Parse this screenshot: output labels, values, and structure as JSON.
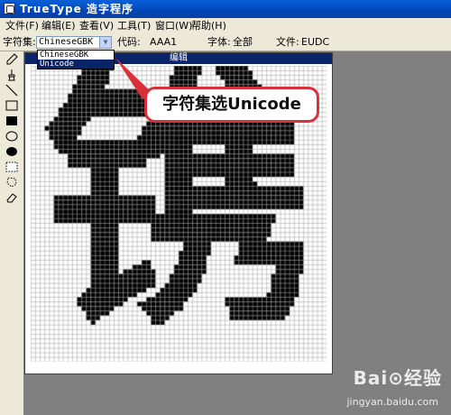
{
  "window": {
    "title": "TrueType 造字程序"
  },
  "menu": [
    {
      "label": "文件(F)"
    },
    {
      "label": "编辑(E)"
    },
    {
      "label": "查看(V)"
    },
    {
      "label": "工具(T)"
    },
    {
      "label": "窗口(W)"
    },
    {
      "label": "帮助(H)"
    }
  ],
  "toolbar": {
    "charset_label": "字符集:",
    "charset_value": "ChineseGBK",
    "code_label": "代码:",
    "code_value": "AAA1",
    "font_label": "字体:",
    "font_value": "全部",
    "file_label": "文件:",
    "file_value": "EUDC"
  },
  "dropdown": {
    "options": [
      {
        "label": "ChineseGBK",
        "selected": false
      },
      {
        "label": "Unicode",
        "selected": true
      }
    ]
  },
  "editor": {
    "title": "编辑",
    "grid_cols": 64,
    "grid_rows": 64,
    "glyph_char": "镌"
  },
  "tools": [
    {
      "icon": "pencil-icon"
    },
    {
      "icon": "brush-icon"
    },
    {
      "icon": "line-icon"
    },
    {
      "icon": "hollow-rectangle-icon"
    },
    {
      "icon": "filled-rectangle-icon"
    },
    {
      "icon": "hollow-ellipse-icon"
    },
    {
      "icon": "filled-ellipse-icon"
    },
    {
      "icon": "rectangular-select-icon"
    },
    {
      "icon": "freeform-select-icon"
    },
    {
      "icon": "eraser-icon"
    }
  ],
  "callout": {
    "text": "字符集选Unicode"
  },
  "watermark": {
    "brand": "Bai⊙经验",
    "url": "jingyan.baidu.com"
  },
  "colors": {
    "title_bar": "#0a5fd8",
    "editor_title": "#0a246a",
    "callout_border": "#d8313a",
    "ink": "#000000"
  }
}
